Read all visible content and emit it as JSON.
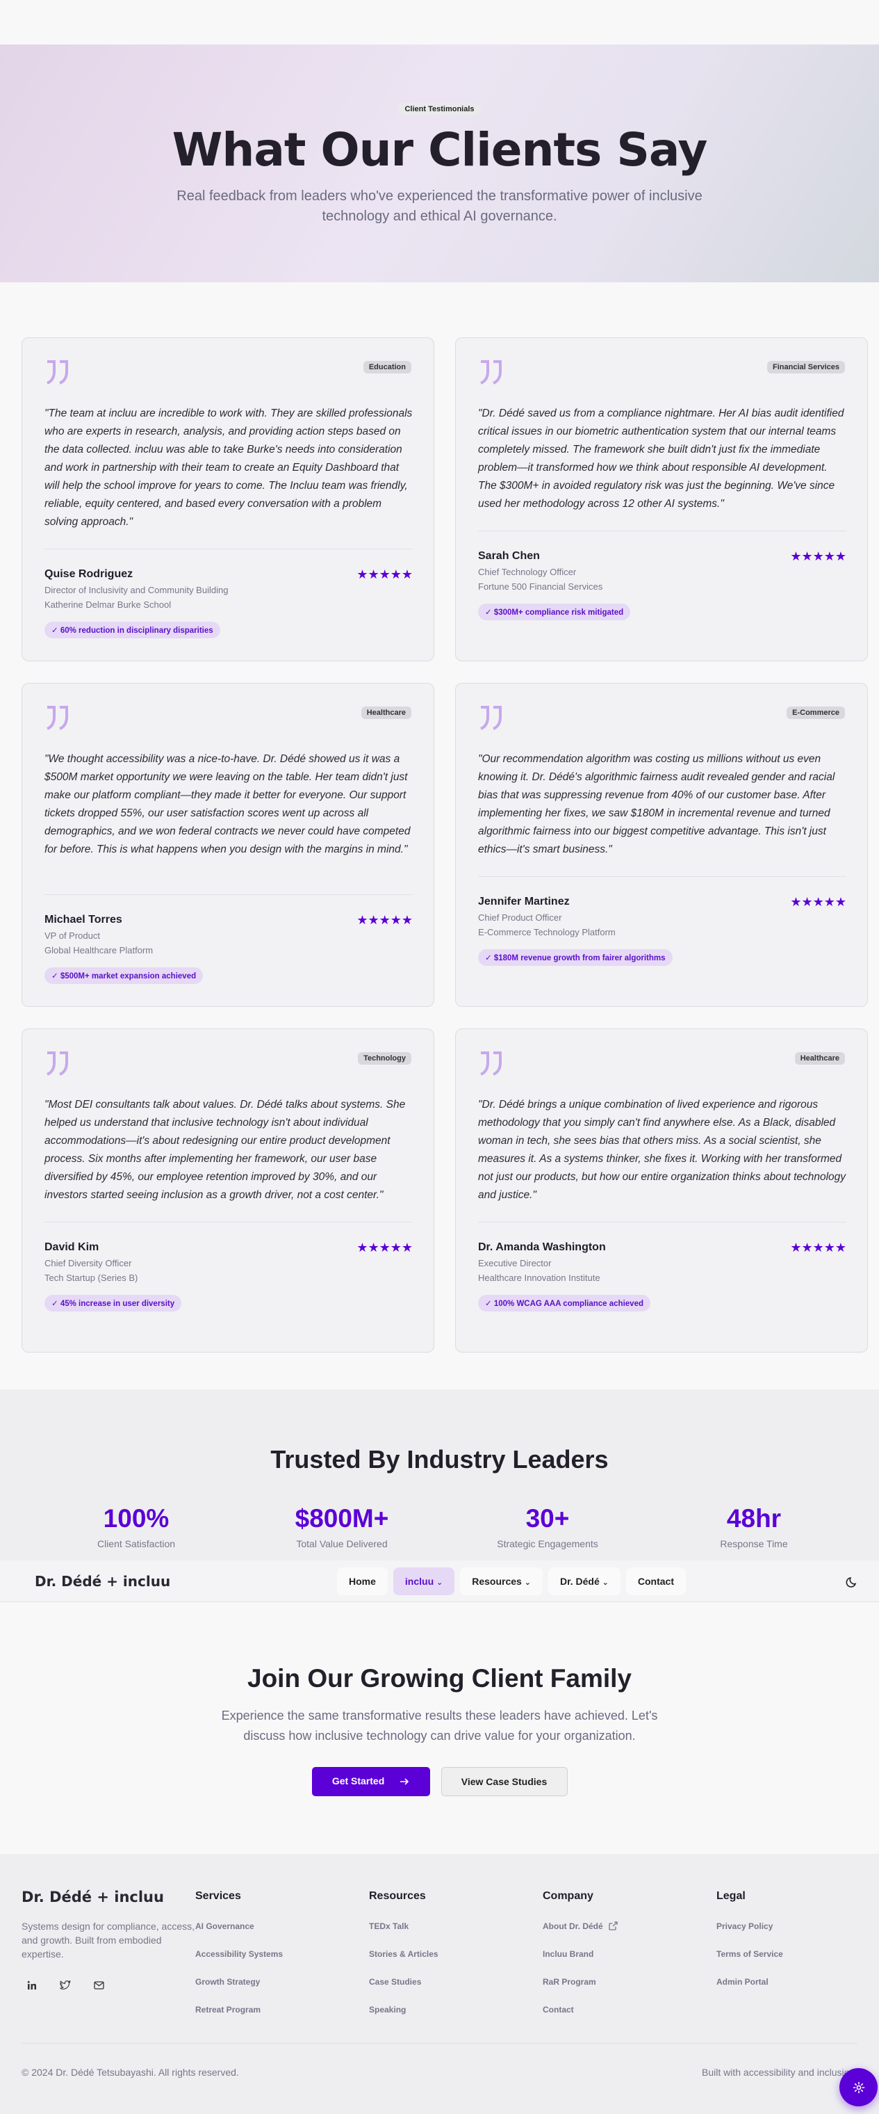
{
  "hero": {
    "badge": "Client Testimonials",
    "title": "What Our Clients Say",
    "subtitle": "Real feedback from leaders who've experienced the transformative power of inclusive technology and ethical AI governance."
  },
  "testimonials": [
    {
      "category": "Education",
      "quote": "\"The team at incluu are incredible to work with. They are skilled professionals who are experts in research, analysis, and providing action steps based on the data collected. incluu was able to take Burke's needs into consideration and work in partnership with their team to create an Equity Dashboard that will help the school improve for years to come. The Incluu team was friendly, reliable, equity centered, and based every conversation with a problem solving approach.\"",
      "name": "Quise Rodriguez",
      "role": "Director of Inclusivity and Community Building",
      "org": "Katherine Delmar Burke School",
      "stars": "★★★★★",
      "result": "✓ 60% reduction in disciplinary disparities"
    },
    {
      "category": "Financial Services",
      "quote": "\"Dr. Dédé saved us from a compliance nightmare. Her AI bias audit identified critical issues in our biometric authentication system that our internal teams completely missed. The framework she built didn't just fix the immediate problem—it transformed how we think about responsible AI development. The $300M+ in avoided regulatory risk was just the beginning. We've since used her methodology across 12 other AI systems.\"",
      "name": "Sarah Chen",
      "role": "Chief Technology Officer",
      "org": "Fortune 500 Financial Services",
      "stars": "★★★★★",
      "result": "✓ $300M+ compliance risk mitigated"
    },
    {
      "category": "Healthcare",
      "quote": "\"We thought accessibility was a nice-to-have. Dr. Dédé showed us it was a $500M market opportunity we were leaving on the table. Her team didn't just make our platform compliant—they made it better for everyone. Our support tickets dropped 55%, our user satisfaction scores went up across all demographics, and we won federal contracts we never could have competed for before. This is what happens when you design with the margins in mind.\"",
      "name": "Michael Torres",
      "role": "VP of Product",
      "org": "Global Healthcare Platform",
      "stars": "★★★★★",
      "result": "✓ $500M+ market expansion achieved"
    },
    {
      "category": "E-Commerce",
      "quote": "\"Our recommendation algorithm was costing us millions without us even knowing it. Dr. Dédé's algorithmic fairness audit revealed gender and racial bias that was suppressing revenue from 40% of our customer base. After implementing her fixes, we saw $180M in incremental revenue and turned algorithmic fairness into our biggest competitive advantage. This isn't just ethics—it's smart business.\"",
      "name": "Jennifer Martinez",
      "role": "Chief Product Officer",
      "org": "E-Commerce Technology Platform",
      "stars": "★★★★★",
      "result": "✓ $180M revenue growth from fairer algorithms"
    },
    {
      "category": "Technology",
      "quote": "\"Most DEI consultants talk about values. Dr. Dédé talks about systems. She helped us understand that inclusive technology isn't about individual accommodations—it's about redesigning our entire product development process. Six months after implementing her framework, our user base diversified by 45%, our employee retention improved by 30%, and our investors started seeing inclusion as a growth driver, not a cost center.\"",
      "name": "David Kim",
      "role": "Chief Diversity Officer",
      "org": "Tech Startup (Series B)",
      "stars": "★★★★★",
      "result": "✓ 45% increase in user diversity"
    },
    {
      "category": "Healthcare",
      "quote": "\"Dr. Dédé brings a unique combination of lived experience and rigorous methodology that you simply can't find anywhere else. As a Black, disabled woman in tech, she sees bias that others miss. As a social scientist, she measures it. As a systems thinker, she fixes it. Working with her transformed not just our products, but how our entire organization thinks about technology and justice.\"",
      "name": "Dr. Amanda Washington",
      "role": "Executive Director",
      "org": "Healthcare Innovation Institute",
      "stars": "★★★★★",
      "result": "✓ 100% WCAG AAA compliance achieved"
    }
  ],
  "stats": {
    "title": "Trusted By Industry Leaders",
    "items": [
      {
        "value": "100%",
        "label": "Client Satisfaction"
      },
      {
        "value": "$800M+",
        "label": "Total Value Delivered"
      },
      {
        "value": "30+",
        "label": "Strategic Engagements"
      },
      {
        "value": "48hr",
        "label": "Response Time"
      }
    ]
  },
  "nav": {
    "brand": "Dr. Dédé + incluu",
    "links": [
      {
        "label": "Home",
        "chevron": ""
      },
      {
        "label": "incluu",
        "chevron": "⌄"
      },
      {
        "label": "Resources",
        "chevron": "⌄"
      },
      {
        "label": "Dr. Dédé",
        "chevron": "⌄"
      },
      {
        "label": "Contact",
        "chevron": ""
      }
    ]
  },
  "cta": {
    "title": "Join Our Growing Client Family",
    "text": "Experience the same transformative results these leaders have achieved. Let's discuss how inclusive technology can drive value for your organization.",
    "primary": "Get Started",
    "secondary": "View Case Studies"
  },
  "footer": {
    "brand": "Dr. Dédé + incluu",
    "description": "Systems design for compliance, access, and growth. Built from embodied expertise.",
    "columns": [
      {
        "title": "Services",
        "links": [
          "AI Governance",
          "Accessibility Systems",
          "Growth Strategy",
          "Retreat Program"
        ]
      },
      {
        "title": "Resources",
        "links": [
          "TEDx Talk",
          "Stories & Articles",
          "Case Studies",
          "Speaking"
        ]
      },
      {
        "title": "Company",
        "links": [
          "About Dr. Dédé",
          "Incluu Brand",
          "RaR Program",
          "Contact"
        ]
      },
      {
        "title": "Legal",
        "links": [
          "Privacy Policy",
          "Terms of Service",
          "Admin Portal"
        ]
      }
    ],
    "copyright": "© 2024 Dr. Dédé Tetsubayashi. All rights reserved.",
    "built": "Built with accessibility and inclusion in"
  },
  "colors": {
    "accent": "#5b00d6",
    "accent_light": "#e6d9f5"
  }
}
